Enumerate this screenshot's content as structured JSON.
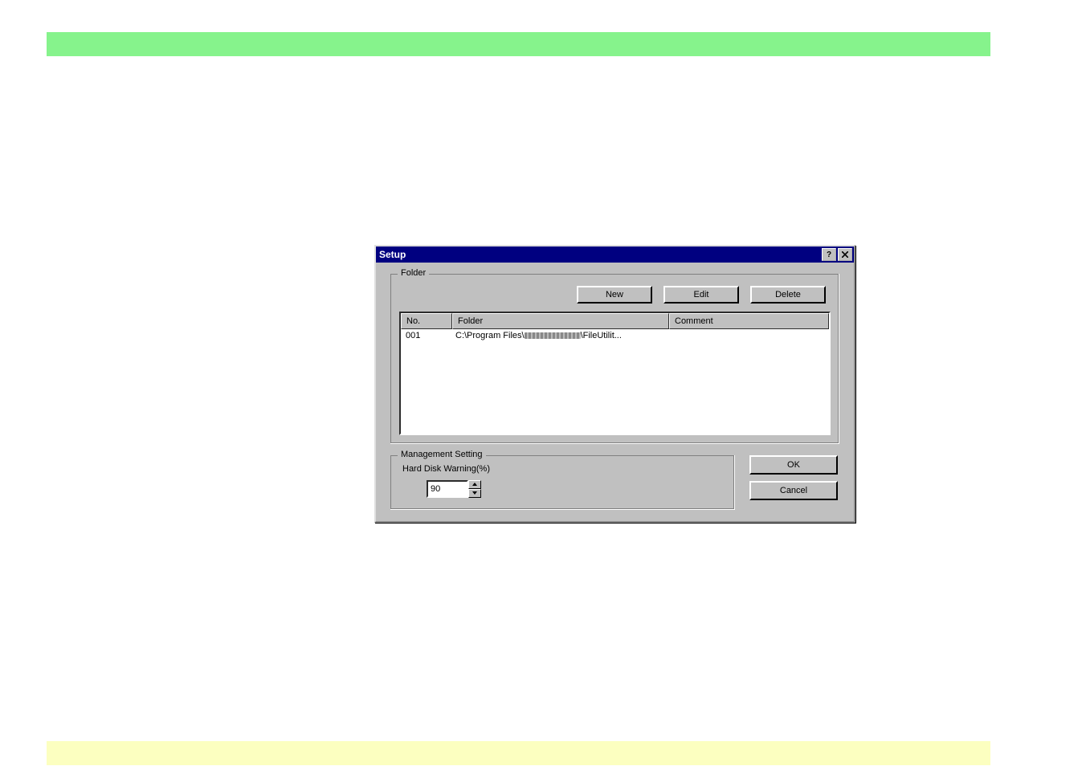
{
  "dialog": {
    "title": "Setup",
    "folder_group_label": "Folder",
    "buttons": {
      "new": "New",
      "edit": "Edit",
      "delete": "Delete",
      "ok": "OK",
      "cancel": "Cancel"
    },
    "columns": {
      "no": "No.",
      "folder": "Folder",
      "comment": "Comment"
    },
    "rows": [
      {
        "no": "001",
        "folder_prefix": "C:\\Program Files\\",
        "folder_suffix": "\\FileUtilit...",
        "comment": ""
      }
    ],
    "mgmt_group_label": "Management Setting",
    "hd_warning_label": "Hard Disk Warning(%)",
    "hd_warning_value": "90"
  }
}
